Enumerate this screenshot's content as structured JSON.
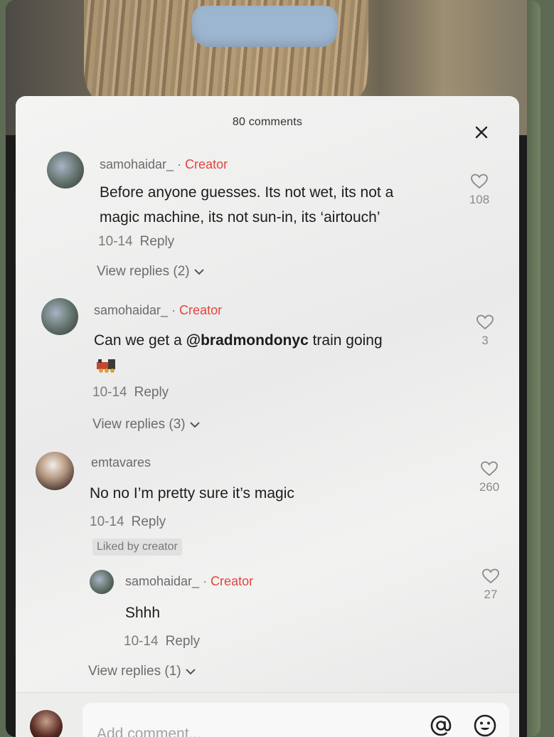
{
  "sheet": {
    "count": "80 comments"
  },
  "comments": [
    {
      "username": "samohaidar_",
      "sep": " · ",
      "badge": "Creator",
      "lines": [
        "Before anyone guesses. Its not wet, its not a",
        "magic machine, its not sun-in, its ‘airtouch’"
      ],
      "date": "10-14",
      "reply": "Reply",
      "view_replies": "View replies (2)",
      "likes": "108"
    },
    {
      "username": "samohaidar_",
      "sep": " · ",
      "badge": "Creator",
      "text_before": "Can we get a ",
      "mention": "@bradmondonyc",
      "text_after": " train going",
      "emoji": "locomotive-emoji",
      "date": "10-14",
      "reply": "Reply",
      "view_replies": "View replies (3)",
      "likes": "3"
    },
    {
      "username": "emtavares",
      "text": "No no I’m pretty sure it’s magic",
      "date": "10-14",
      "reply": "Reply",
      "liked_by": "Liked by creator",
      "likes": "260",
      "nested": {
        "username": "samohaidar_",
        "sep": " · ",
        "badge": "Creator",
        "text": "Shhh",
        "date": "10-14",
        "reply": "Reply",
        "likes": "27"
      },
      "view_replies": "View replies (1)"
    }
  ],
  "input": {
    "placeholder": "Add comment...",
    "mention_icon": "at-icon",
    "emoji_icon": "emoji-icon"
  },
  "colors": {
    "creator": "#e0453e",
    "sheet": "#f4f4f3"
  }
}
